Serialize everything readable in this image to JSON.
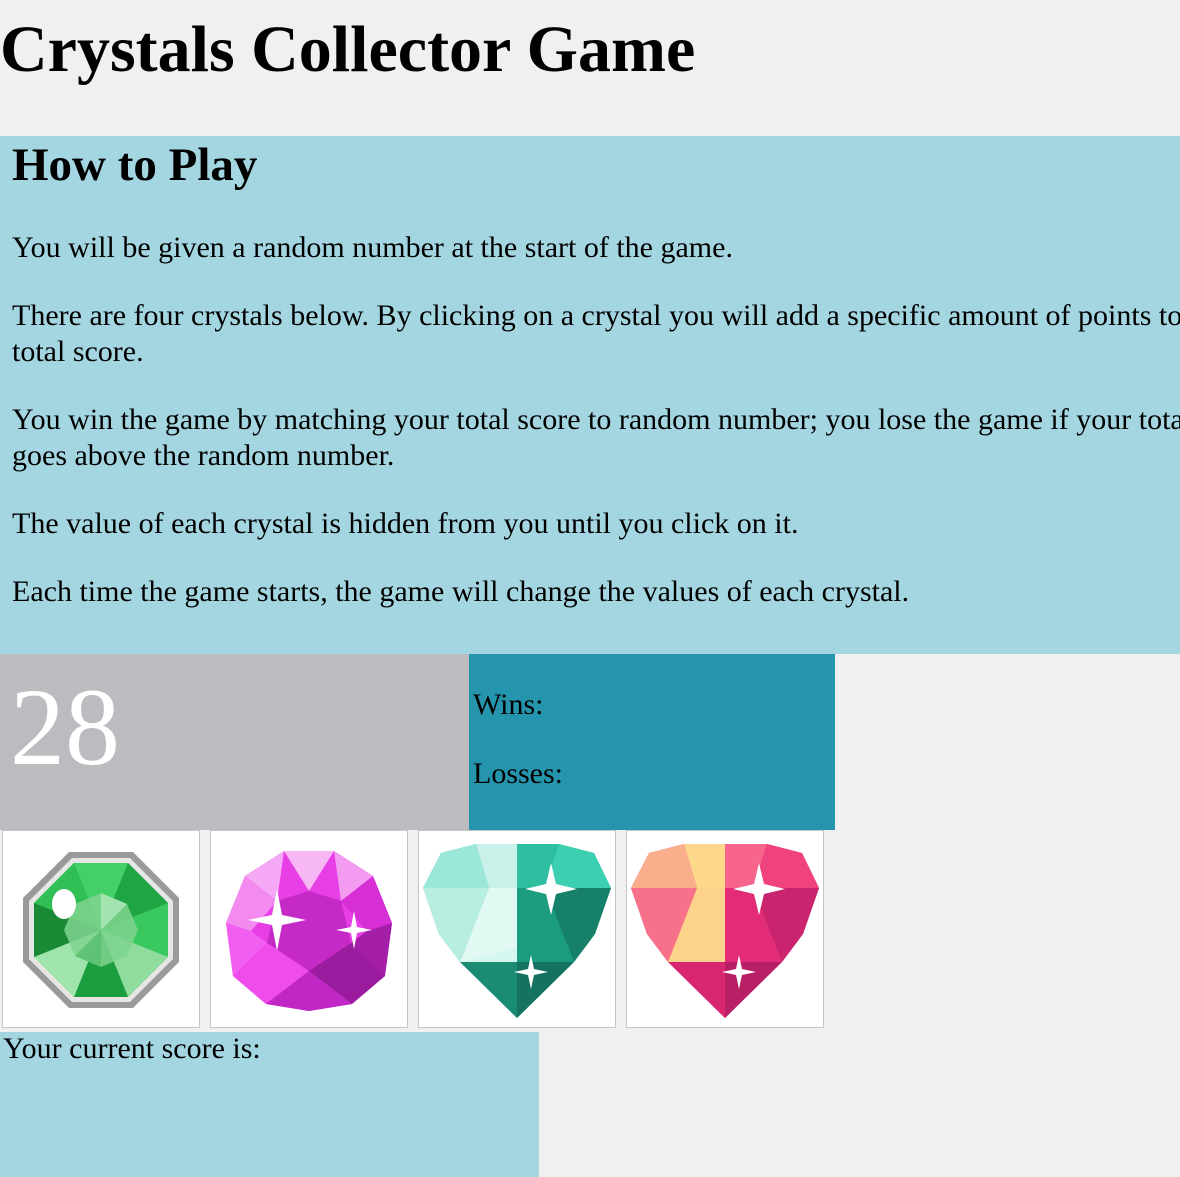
{
  "title": "Crystals Collector Game",
  "instructions": {
    "heading": "How to Play",
    "paragraphs": [
      "You will be given a random number at the start of the game.",
      "There are four crystals below. By clicking on a crystal you will add a specific amount of points to your total score.",
      "You win the game by matching your total score to random number; you lose the game if your total score goes above the random number.",
      "The value of each crystal is hidden from you until you click on it.",
      "Each time the game starts, the game will change the values of each crystal."
    ]
  },
  "target_number": "28",
  "stats": {
    "wins_label": "Wins:",
    "losses_label": "Losses:"
  },
  "crystals": [
    {
      "name": "green-octagon-crystal-icon",
      "color": "#2fbf54"
    },
    {
      "name": "pink-crystal-icon",
      "color": "#e83ee6"
    },
    {
      "name": "teal-diamond-icon",
      "color": "#2fbfa0"
    },
    {
      "name": "pink-orange-diamond-icon",
      "color": "#e8327a"
    }
  ],
  "score": {
    "label": "Your current score is:"
  },
  "colors": {
    "page_background": "#f0f0f0",
    "instructions_background": "#a4d6e1",
    "target_background": "#bcbbbf",
    "stats_background": "#2595ad",
    "score_background": "#a4d6e1"
  }
}
